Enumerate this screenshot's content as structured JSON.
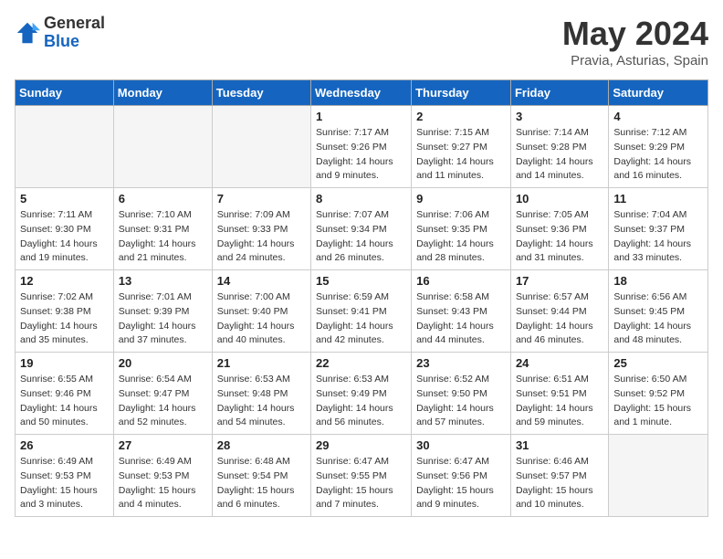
{
  "header": {
    "logo_general": "General",
    "logo_blue": "Blue",
    "month_title": "May 2024",
    "location": "Pravia, Asturias, Spain"
  },
  "days_of_week": [
    "Sunday",
    "Monday",
    "Tuesday",
    "Wednesday",
    "Thursday",
    "Friday",
    "Saturday"
  ],
  "weeks": [
    [
      {
        "day": "",
        "empty": true
      },
      {
        "day": "",
        "empty": true
      },
      {
        "day": "",
        "empty": true
      },
      {
        "day": "1",
        "sunrise": "Sunrise: 7:17 AM",
        "sunset": "Sunset: 9:26 PM",
        "daylight": "Daylight: 14 hours and 9 minutes."
      },
      {
        "day": "2",
        "sunrise": "Sunrise: 7:15 AM",
        "sunset": "Sunset: 9:27 PM",
        "daylight": "Daylight: 14 hours and 11 minutes."
      },
      {
        "day": "3",
        "sunrise": "Sunrise: 7:14 AM",
        "sunset": "Sunset: 9:28 PM",
        "daylight": "Daylight: 14 hours and 14 minutes."
      },
      {
        "day": "4",
        "sunrise": "Sunrise: 7:12 AM",
        "sunset": "Sunset: 9:29 PM",
        "daylight": "Daylight: 14 hours and 16 minutes."
      }
    ],
    [
      {
        "day": "5",
        "sunrise": "Sunrise: 7:11 AM",
        "sunset": "Sunset: 9:30 PM",
        "daylight": "Daylight: 14 hours and 19 minutes."
      },
      {
        "day": "6",
        "sunrise": "Sunrise: 7:10 AM",
        "sunset": "Sunset: 9:31 PM",
        "daylight": "Daylight: 14 hours and 21 minutes."
      },
      {
        "day": "7",
        "sunrise": "Sunrise: 7:09 AM",
        "sunset": "Sunset: 9:33 PM",
        "daylight": "Daylight: 14 hours and 24 minutes."
      },
      {
        "day": "8",
        "sunrise": "Sunrise: 7:07 AM",
        "sunset": "Sunset: 9:34 PM",
        "daylight": "Daylight: 14 hours and 26 minutes."
      },
      {
        "day": "9",
        "sunrise": "Sunrise: 7:06 AM",
        "sunset": "Sunset: 9:35 PM",
        "daylight": "Daylight: 14 hours and 28 minutes."
      },
      {
        "day": "10",
        "sunrise": "Sunrise: 7:05 AM",
        "sunset": "Sunset: 9:36 PM",
        "daylight": "Daylight: 14 hours and 31 minutes."
      },
      {
        "day": "11",
        "sunrise": "Sunrise: 7:04 AM",
        "sunset": "Sunset: 9:37 PM",
        "daylight": "Daylight: 14 hours and 33 minutes."
      }
    ],
    [
      {
        "day": "12",
        "sunrise": "Sunrise: 7:02 AM",
        "sunset": "Sunset: 9:38 PM",
        "daylight": "Daylight: 14 hours and 35 minutes."
      },
      {
        "day": "13",
        "sunrise": "Sunrise: 7:01 AM",
        "sunset": "Sunset: 9:39 PM",
        "daylight": "Daylight: 14 hours and 37 minutes."
      },
      {
        "day": "14",
        "sunrise": "Sunrise: 7:00 AM",
        "sunset": "Sunset: 9:40 PM",
        "daylight": "Daylight: 14 hours and 40 minutes."
      },
      {
        "day": "15",
        "sunrise": "Sunrise: 6:59 AM",
        "sunset": "Sunset: 9:41 PM",
        "daylight": "Daylight: 14 hours and 42 minutes."
      },
      {
        "day": "16",
        "sunrise": "Sunrise: 6:58 AM",
        "sunset": "Sunset: 9:43 PM",
        "daylight": "Daylight: 14 hours and 44 minutes."
      },
      {
        "day": "17",
        "sunrise": "Sunrise: 6:57 AM",
        "sunset": "Sunset: 9:44 PM",
        "daylight": "Daylight: 14 hours and 46 minutes."
      },
      {
        "day": "18",
        "sunrise": "Sunrise: 6:56 AM",
        "sunset": "Sunset: 9:45 PM",
        "daylight": "Daylight: 14 hours and 48 minutes."
      }
    ],
    [
      {
        "day": "19",
        "sunrise": "Sunrise: 6:55 AM",
        "sunset": "Sunset: 9:46 PM",
        "daylight": "Daylight: 14 hours and 50 minutes."
      },
      {
        "day": "20",
        "sunrise": "Sunrise: 6:54 AM",
        "sunset": "Sunset: 9:47 PM",
        "daylight": "Daylight: 14 hours and 52 minutes."
      },
      {
        "day": "21",
        "sunrise": "Sunrise: 6:53 AM",
        "sunset": "Sunset: 9:48 PM",
        "daylight": "Daylight: 14 hours and 54 minutes."
      },
      {
        "day": "22",
        "sunrise": "Sunrise: 6:53 AM",
        "sunset": "Sunset: 9:49 PM",
        "daylight": "Daylight: 14 hours and 56 minutes."
      },
      {
        "day": "23",
        "sunrise": "Sunrise: 6:52 AM",
        "sunset": "Sunset: 9:50 PM",
        "daylight": "Daylight: 14 hours and 57 minutes."
      },
      {
        "day": "24",
        "sunrise": "Sunrise: 6:51 AM",
        "sunset": "Sunset: 9:51 PM",
        "daylight": "Daylight: 14 hours and 59 minutes."
      },
      {
        "day": "25",
        "sunrise": "Sunrise: 6:50 AM",
        "sunset": "Sunset: 9:52 PM",
        "daylight": "Daylight: 15 hours and 1 minute."
      }
    ],
    [
      {
        "day": "26",
        "sunrise": "Sunrise: 6:49 AM",
        "sunset": "Sunset: 9:53 PM",
        "daylight": "Daylight: 15 hours and 3 minutes."
      },
      {
        "day": "27",
        "sunrise": "Sunrise: 6:49 AM",
        "sunset": "Sunset: 9:53 PM",
        "daylight": "Daylight: 15 hours and 4 minutes."
      },
      {
        "day": "28",
        "sunrise": "Sunrise: 6:48 AM",
        "sunset": "Sunset: 9:54 PM",
        "daylight": "Daylight: 15 hours and 6 minutes."
      },
      {
        "day": "29",
        "sunrise": "Sunrise: 6:47 AM",
        "sunset": "Sunset: 9:55 PM",
        "daylight": "Daylight: 15 hours and 7 minutes."
      },
      {
        "day": "30",
        "sunrise": "Sunrise: 6:47 AM",
        "sunset": "Sunset: 9:56 PM",
        "daylight": "Daylight: 15 hours and 9 minutes."
      },
      {
        "day": "31",
        "sunrise": "Sunrise: 6:46 AM",
        "sunset": "Sunset: 9:57 PM",
        "daylight": "Daylight: 15 hours and 10 minutes."
      },
      {
        "day": "",
        "empty": true
      }
    ]
  ]
}
